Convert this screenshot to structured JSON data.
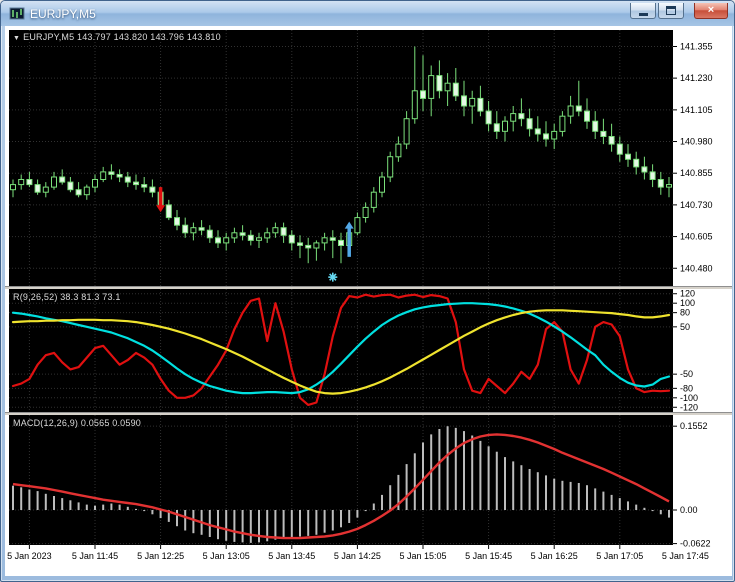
{
  "window": {
    "title": "EURJPY,M5",
    "close_glyph": "×",
    "colors": {
      "titlebar": "#a9c7e7",
      "frame": "#9cbbde",
      "close_button": "#c74f3a"
    }
  },
  "chart": {
    "header_toggle": "▼",
    "header": "EURJPY,M5 143.797 143.820 143.796 143.810"
  },
  "indicators": {
    "r_label": "R(9,26,52) 38.3 81.3 73.1",
    "macd_label": "MACD(12,26,9) 0.0565 0.0590"
  },
  "axes": {
    "time_labels": [
      {
        "i": 2,
        "t": "5 Jan 2023"
      },
      {
        "i": 10,
        "t": "5 Jan 11:45"
      },
      {
        "i": 18,
        "t": "5 Jan 12:25"
      },
      {
        "i": 26,
        "t": "5 Jan 13:05"
      },
      {
        "i": 34,
        "t": "5 Jan 13:45"
      },
      {
        "i": 42,
        "t": "5 Jan 14:25"
      },
      {
        "i": 50,
        "t": "5 Jan 15:05"
      },
      {
        "i": 58,
        "t": "5 Jan 15:45"
      },
      {
        "i": 66,
        "t": "5 Jan 16:25"
      },
      {
        "i": 74,
        "t": "5 Jan 17:05"
      },
      {
        "i": 82,
        "t": "5 Jan 17:45"
      }
    ]
  },
  "chart_data": [
    {
      "panel": "main",
      "type": "candlestick",
      "symbol": "EURJPY",
      "timeframe": "M5",
      "current_ohlc": {
        "open": "143.797",
        "high": "143.820",
        "low": "143.796",
        "close": "143.810"
      },
      "y_range": [
        140.41,
        141.42
      ],
      "y_labels": [
        {
          "v": 141.355,
          "t": "141.355"
        },
        {
          "v": 141.23,
          "t": "141.230"
        },
        {
          "v": 141.105,
          "t": "141.105"
        },
        {
          "v": 140.98,
          "t": "140.980"
        },
        {
          "v": 140.855,
          "t": "140.855"
        },
        {
          "v": 140.73,
          "t": "140.730"
        },
        {
          "v": 140.605,
          "t": "140.605"
        },
        {
          "v": 140.48,
          "t": "140.480"
        }
      ],
      "colors": {
        "bg": "#000000",
        "grid": "#313131",
        "bull_fill": "#000000",
        "bear_fill": "#e4f9e4",
        "outline": "#7be07b",
        "wick": "#7be07b"
      },
      "candles": [
        [
          140.79,
          140.83,
          140.76,
          140.81
        ],
        [
          140.81,
          140.85,
          140.79,
          140.83
        ],
        [
          140.83,
          140.86,
          140.8,
          140.81
        ],
        [
          140.81,
          140.83,
          140.77,
          140.78
        ],
        [
          140.78,
          140.82,
          140.76,
          140.8
        ],
        [
          140.8,
          140.86,
          140.79,
          140.84
        ],
        [
          140.84,
          140.87,
          140.81,
          140.82
        ],
        [
          140.82,
          140.84,
          140.78,
          140.79
        ],
        [
          140.79,
          140.82,
          140.76,
          140.77
        ],
        [
          140.77,
          140.81,
          140.75,
          140.8
        ],
        [
          140.8,
          140.85,
          140.78,
          140.83
        ],
        [
          140.83,
          140.88,
          140.82,
          140.86
        ],
        [
          140.86,
          140.89,
          140.83,
          140.85
        ],
        [
          140.85,
          140.87,
          140.82,
          140.84
        ],
        [
          140.84,
          140.86,
          140.8,
          140.82
        ],
        [
          140.82,
          140.85,
          140.79,
          140.81
        ],
        [
          140.81,
          140.84,
          140.78,
          140.8
        ],
        [
          140.8,
          140.83,
          140.76,
          140.78
        ],
        [
          140.78,
          140.8,
          140.72,
          140.73
        ],
        [
          140.73,
          140.75,
          140.67,
          140.68
        ],
        [
          140.68,
          140.71,
          140.63,
          140.65
        ],
        [
          140.65,
          140.68,
          140.6,
          140.62
        ],
        [
          140.62,
          140.66,
          140.59,
          140.64
        ],
        [
          140.64,
          140.67,
          140.61,
          140.63
        ],
        [
          140.63,
          140.65,
          140.58,
          140.6
        ],
        [
          140.6,
          140.63,
          140.56,
          140.58
        ],
        [
          140.58,
          140.62,
          140.55,
          140.6
        ],
        [
          140.6,
          140.64,
          140.58,
          140.62
        ],
        [
          140.62,
          140.65,
          140.59,
          140.61
        ],
        [
          140.61,
          140.63,
          140.57,
          140.59
        ],
        [
          140.59,
          140.62,
          140.56,
          140.6
        ],
        [
          140.6,
          140.64,
          140.58,
          140.62
        ],
        [
          140.62,
          140.66,
          140.6,
          140.64
        ],
        [
          140.64,
          140.66,
          140.58,
          140.61
        ],
        [
          140.61,
          140.63,
          140.55,
          140.58
        ],
        [
          140.58,
          140.61,
          140.52,
          140.57
        ],
        [
          140.57,
          140.6,
          140.5,
          140.56
        ],
        [
          140.56,
          140.59,
          140.51,
          140.58
        ],
        [
          140.58,
          140.62,
          140.55,
          140.6
        ],
        [
          140.6,
          140.63,
          140.52,
          140.59
        ],
        [
          140.59,
          140.62,
          140.5,
          140.57
        ],
        [
          140.57,
          140.64,
          140.56,
          140.62
        ],
        [
          140.62,
          140.7,
          140.61,
          140.68
        ],
        [
          140.68,
          140.74,
          140.66,
          140.72
        ],
        [
          140.72,
          140.8,
          140.7,
          140.78
        ],
        [
          140.78,
          140.86,
          140.76,
          140.84
        ],
        [
          140.84,
          140.94,
          140.82,
          140.92
        ],
        [
          140.92,
          141.0,
          140.9,
          140.97
        ],
        [
          140.97,
          141.1,
          140.95,
          141.07
        ],
        [
          141.07,
          141.355,
          141.05,
          141.18
        ],
        [
          141.18,
          141.32,
          141.1,
          141.15
        ],
        [
          141.15,
          141.28,
          141.08,
          141.24
        ],
        [
          141.24,
          141.3,
          141.15,
          141.18
        ],
        [
          141.18,
          141.25,
          141.12,
          141.21
        ],
        [
          141.21,
          141.27,
          141.14,
          141.16
        ],
        [
          141.16,
          141.22,
          141.08,
          141.12
        ],
        [
          141.12,
          141.18,
          141.05,
          141.15
        ],
        [
          141.15,
          141.2,
          141.08,
          141.1
        ],
        [
          141.1,
          141.14,
          141.02,
          141.05
        ],
        [
          141.05,
          141.1,
          140.99,
          141.02
        ],
        [
          141.02,
          141.08,
          140.98,
          141.06
        ],
        [
          141.06,
          141.12,
          141.02,
          141.09
        ],
        [
          141.09,
          141.15,
          141.04,
          141.07
        ],
        [
          141.07,
          141.11,
          141.0,
          141.03
        ],
        [
          141.03,
          141.08,
          140.98,
          141.01
        ],
        [
          141.01,
          141.06,
          140.96,
          140.99
        ],
        [
          140.99,
          141.05,
          140.95,
          141.02
        ],
        [
          141.02,
          141.1,
          141.0,
          141.08
        ],
        [
          141.08,
          141.16,
          141.05,
          141.12
        ],
        [
          141.12,
          141.22,
          141.08,
          141.1
        ],
        [
          141.1,
          141.15,
          141.03,
          141.06
        ],
        [
          141.06,
          141.1,
          140.99,
          141.02
        ],
        [
          141.02,
          141.07,
          140.97,
          141.0
        ],
        [
          141.0,
          141.05,
          140.94,
          140.97
        ],
        [
          140.97,
          141.0,
          140.9,
          140.93
        ],
        [
          140.93,
          140.97,
          140.88,
          140.91
        ],
        [
          140.91,
          140.94,
          140.85,
          140.88
        ],
        [
          140.88,
          140.92,
          140.83,
          140.86
        ],
        [
          140.86,
          140.89,
          140.8,
          140.83
        ],
        [
          140.83,
          140.86,
          140.77,
          140.8
        ],
        [
          140.8,
          140.84,
          140.76,
          140.81
        ]
      ],
      "markers": [
        {
          "type": "sell-arrow",
          "color": "#e01010",
          "index": 18,
          "from_price": 140.8,
          "to_price": 140.705
        },
        {
          "type": "buy-arrow",
          "color": "#53a9e8",
          "index": 41,
          "from_price": 140.525,
          "to_price": 140.66
        },
        {
          "type": "star",
          "color": "#66d9f2",
          "index": 39,
          "price": 140.445
        }
      ]
    },
    {
      "panel": "R",
      "type": "line",
      "label": "R(9,26,52)",
      "values_text": "38.3 81.3 73.1",
      "y_range": [
        -130,
        130
      ],
      "y_labels": [
        {
          "v": 120,
          "t": "120"
        },
        {
          "v": 100,
          "t": "100"
        },
        {
          "v": 80,
          "t": "80"
        },
        {
          "v": 50,
          "t": "50"
        },
        {
          "v": -50,
          "t": "-50"
        },
        {
          "v": -80,
          "t": "-80"
        },
        {
          "v": -100,
          "t": "-100"
        },
        {
          "v": -120,
          "t": "-120"
        }
      ],
      "series": [
        {
          "name": "fast",
          "color": "#e01010",
          "values": [
            -75,
            -70,
            -60,
            -30,
            -10,
            -5,
            -25,
            -40,
            -35,
            -15,
            5,
            10,
            -10,
            -30,
            -20,
            -5,
            -15,
            -30,
            -60,
            -85,
            -100,
            -100,
            -95,
            -80,
            -55,
            -30,
            0,
            45,
            80,
            105,
            110,
            20,
            100,
            40,
            -40,
            -100,
            -115,
            -110,
            -50,
            30,
            90,
            115,
            112,
            118,
            114,
            117,
            118,
            112,
            116,
            118,
            113,
            117,
            115,
            110,
            60,
            -40,
            -85,
            -90,
            -60,
            -75,
            -90,
            -70,
            -45,
            -60,
            -30,
            45,
            60,
            40,
            -40,
            -70,
            -20,
            50,
            60,
            55,
            30,
            -40,
            -80,
            -88,
            -85,
            -86,
            -85
          ]
        },
        {
          "name": "mid",
          "color": "#00e0e0",
          "values": [
            80,
            78,
            75,
            72,
            68,
            65,
            62,
            58,
            54,
            50,
            46,
            42,
            38,
            32,
            26,
            18,
            10,
            0,
            -12,
            -25,
            -38,
            -50,
            -60,
            -68,
            -75,
            -80,
            -85,
            -88,
            -90,
            -90,
            -89,
            -88,
            -88,
            -89,
            -90,
            -88,
            -82,
            -72,
            -60,
            -45,
            -28,
            -10,
            8,
            25,
            40,
            54,
            65,
            74,
            81,
            87,
            91,
            94,
            96,
            98,
            99,
            100,
            100,
            99,
            98,
            96,
            93,
            89,
            84,
            78,
            70,
            61,
            51,
            40,
            28,
            15,
            2,
            -10,
            -30,
            -45,
            -58,
            -68,
            -74,
            -76,
            -72,
            -60,
            -55
          ]
        },
        {
          "name": "slow",
          "color": "#efe32e",
          "values": [
            60,
            61,
            62,
            62,
            63,
            63,
            64,
            64,
            65,
            65,
            65,
            64,
            64,
            63,
            62,
            60,
            57,
            54,
            50,
            46,
            41,
            36,
            30,
            24,
            17,
            10,
            3,
            -5,
            -13,
            -22,
            -31,
            -40,
            -49,
            -58,
            -66,
            -74,
            -81,
            -87,
            -90,
            -91,
            -90,
            -87,
            -83,
            -78,
            -72,
            -65,
            -57,
            -48,
            -39,
            -29,
            -19,
            -9,
            1,
            11,
            21,
            31,
            40,
            49,
            57,
            64,
            70,
            75,
            79,
            82,
            84,
            85,
            85,
            85,
            84,
            83,
            82,
            81,
            80,
            79,
            77,
            75,
            72,
            70,
            70,
            72,
            75
          ]
        }
      ]
    },
    {
      "panel": "MACD",
      "type": "bar",
      "label": "MACD(12,26,9)",
      "values_text": "0.0565 0.0590",
      "y_range": [
        -0.0648,
        0.1759
      ],
      "y_labels": [
        {
          "v": 0.1552,
          "t": "0.1552"
        },
        {
          "v": 0,
          "t": "0.00"
        },
        {
          "v": -0.0622,
          "t": "-0.0622"
        }
      ],
      "histogram": {
        "color": "#bdbdbd",
        "values": [
          0.045,
          0.042,
          0.038,
          0.035,
          0.03,
          0.026,
          0.022,
          0.018,
          0.014,
          0.01,
          0.008,
          0.01,
          0.012,
          0.01,
          0.006,
          0.002,
          -0.002,
          -0.008,
          -0.015,
          -0.022,
          -0.03,
          -0.038,
          -0.043,
          -0.046,
          -0.05,
          -0.054,
          -0.057,
          -0.059,
          -0.06,
          -0.061,
          -0.06,
          -0.058,
          -0.055,
          -0.052,
          -0.05,
          -0.049,
          -0.048,
          -0.046,
          -0.042,
          -0.038,
          -0.032,
          -0.024,
          -0.014,
          -0.002,
          0.012,
          0.028,
          0.046,
          0.065,
          0.085,
          0.105,
          0.125,
          0.14,
          0.15,
          0.1552,
          0.152,
          0.146,
          0.138,
          0.128,
          0.118,
          0.108,
          0.098,
          0.09,
          0.083,
          0.076,
          0.07,
          0.064,
          0.058,
          0.054,
          0.052,
          0.05,
          0.046,
          0.04,
          0.034,
          0.028,
          0.022,
          0.016,
          0.01,
          0.004,
          -0.002,
          -0.008,
          -0.014
        ]
      },
      "signal": {
        "color": "#e23232",
        "values": [
          0.048,
          0.046,
          0.044,
          0.042,
          0.04,
          0.037,
          0.034,
          0.031,
          0.028,
          0.025,
          0.022,
          0.019,
          0.017,
          0.015,
          0.013,
          0.011,
          0.008,
          0.005,
          0.001,
          -0.003,
          -0.008,
          -0.013,
          -0.018,
          -0.023,
          -0.028,
          -0.032,
          -0.036,
          -0.04,
          -0.043,
          -0.046,
          -0.048,
          -0.05,
          -0.051,
          -0.052,
          -0.052,
          -0.052,
          -0.051,
          -0.05,
          -0.049,
          -0.047,
          -0.044,
          -0.04,
          -0.035,
          -0.028,
          -0.02,
          -0.011,
          -0.001,
          0.011,
          0.025,
          0.04,
          0.056,
          0.072,
          0.088,
          0.102,
          0.114,
          0.124,
          0.131,
          0.136,
          0.139,
          0.14,
          0.139,
          0.137,
          0.134,
          0.13,
          0.125,
          0.119,
          0.113,
          0.106,
          0.1,
          0.094,
          0.088,
          0.082,
          0.076,
          0.069,
          0.062,
          0.055,
          0.048,
          0.04,
          0.032,
          0.024,
          0.016
        ]
      }
    }
  ]
}
